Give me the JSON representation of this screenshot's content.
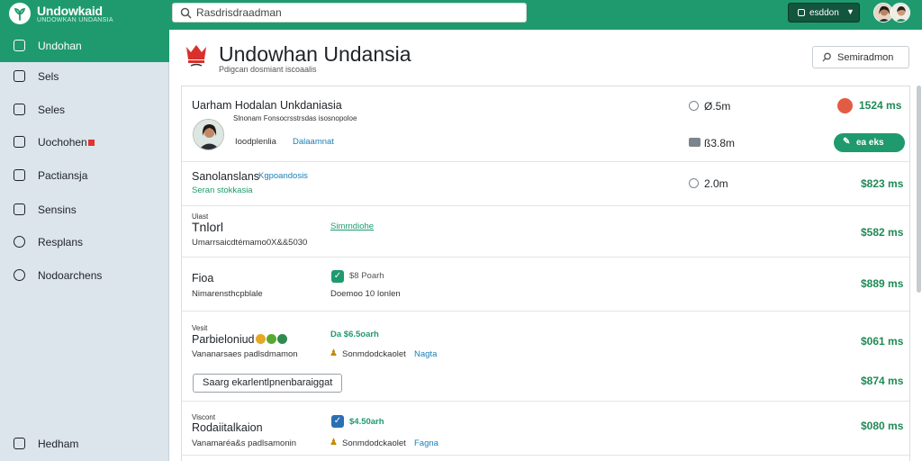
{
  "app": {
    "name": "Undowkaid",
    "tagline": "UNDOWKAN UNDANSIA",
    "search_placeholder": "Rasdrisdraadman",
    "account_button": "esddon",
    "colors": {
      "primary": "#1f9a6e",
      "sidebar_bg": "#dce5ec",
      "price_green": "#1f8a55",
      "alert_red": "#e0342e"
    }
  },
  "sidebar": {
    "items": [
      {
        "label": "Undohan",
        "icon": "tree-icon",
        "active": true
      },
      {
        "label": "Sels",
        "icon": "camera-icon"
      },
      {
        "label": "Seles",
        "icon": "list-icon"
      },
      {
        "label": "Uochohen",
        "icon": "monitor-icon",
        "alert": true
      },
      {
        "label": "Pactiansja",
        "icon": "check-icon"
      },
      {
        "label": "Sensins",
        "icon": "document-icon"
      },
      {
        "label": "Resplans",
        "icon": "gauge-icon"
      },
      {
        "label": "Nodoarchens",
        "icon": "users-icon"
      }
    ],
    "footer_label": "Hedham"
  },
  "header": {
    "title": "Undowhan Undansia",
    "subtitle": "Pdigcan dosmiant iscoaalis",
    "button_label": "Semiradmon"
  },
  "list": {
    "rows": [
      {
        "title": "Uarham Hodalan Unkdaniasia",
        "subtitle": "Slnonam Fonsocrsstrsdas isosnopoloe",
        "metric": "Ø.5m",
        "price": "1524 ms",
        "person_label": "Ioodplenlia",
        "person_link": "Dalaamnat",
        "metric2": "ß3.8m",
        "pill": "ea eks"
      },
      {
        "title": "Sanolanslans",
        "title_link": "Kgpoandosis",
        "subtitle": "Seran stokkasia",
        "metric": "2.0m",
        "price": "$823 ms"
      },
      {
        "small": "Uiast",
        "title": "Tnlorl",
        "subtitle": "Umarrsaicdtémamo0X&&5030",
        "link": "Simrndiohe",
        "price": "$582 ms"
      },
      {
        "title": "Fioa",
        "subtitle": "Nimarensthcpblale",
        "check_label": "$8 Poarh",
        "check_sub": "Doemoo 10 Ionlen",
        "price": "$889 ms"
      },
      {
        "small": "Vesit",
        "title": "Parbieloniud",
        "subtitle": "Vananarsaes padlsdmamon",
        "check_label": "Da  $6.5oarh",
        "person_label": "Sonmdodckaolet",
        "person_link": "Nagta",
        "price": "$061 ms",
        "button": "Saarg ekarlentlpnenbaraiggat",
        "price2": "$874 ms"
      },
      {
        "small": "Viscont",
        "title": "Rodaiitalkaion",
        "subtitle": "Vanamaréa&s padlsamonin",
        "check_label": "$4.50arh",
        "person_label": "Sonmdodckaolet",
        "person_link": "Fagna",
        "price": "$080 ms"
      }
    ]
  }
}
